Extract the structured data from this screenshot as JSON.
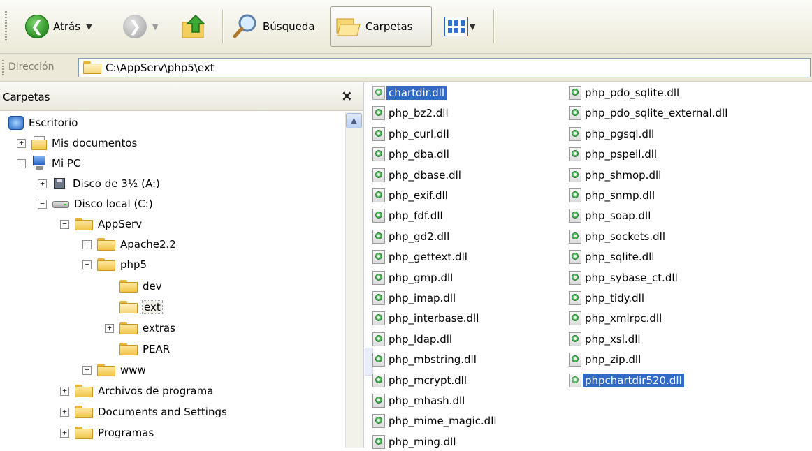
{
  "toolbar": {
    "back_label": "Atrás",
    "search_label": "Búsqueda",
    "folders_label": "Carpetas"
  },
  "address": {
    "label": "Dirección",
    "path": "C:\\AppServ\\php5\\ext"
  },
  "tree": {
    "title": "Carpetas",
    "close": "×",
    "nodes": [
      {
        "label": "Escritorio",
        "icon": "desktop-icon"
      },
      {
        "label": "Mis documentos",
        "icon": "my-documents-icon",
        "toggle": "+"
      },
      {
        "label": "Mi PC",
        "icon": "my-computer-icon",
        "toggle": "−"
      },
      {
        "label": "Disco de 3½ (A:)",
        "icon": "floppy-drive-icon",
        "toggle": "+"
      },
      {
        "label": "Disco local (C:)",
        "icon": "hard-drive-icon",
        "toggle": "−"
      },
      {
        "label": "AppServ",
        "icon": "folder-icon",
        "toggle": "−"
      },
      {
        "label": "Apache2.2",
        "icon": "folder-icon",
        "toggle": "+"
      },
      {
        "label": "php5",
        "icon": "folder-icon",
        "toggle": "−"
      },
      {
        "label": "dev",
        "icon": "folder-icon"
      },
      {
        "label": "ext",
        "icon": "open-folder-icon",
        "selected": true
      },
      {
        "label": "extras",
        "icon": "folder-icon",
        "toggle": "+"
      },
      {
        "label": "PEAR",
        "icon": "folder-icon"
      },
      {
        "label": "www",
        "icon": "folder-icon",
        "toggle": "+"
      },
      {
        "label": "Archivos de programa",
        "icon": "folder-icon",
        "toggle": "+"
      },
      {
        "label": "Documents and Settings",
        "icon": "folder-icon",
        "toggle": "+"
      },
      {
        "label": "Programas",
        "icon": "folder-icon",
        "toggle": "+"
      }
    ]
  },
  "files": {
    "column1": [
      {
        "name": "chartdir.dll",
        "selected": true
      },
      {
        "name": "php_bz2.dll"
      },
      {
        "name": "php_curl.dll"
      },
      {
        "name": "php_dba.dll"
      },
      {
        "name": "php_dbase.dll"
      },
      {
        "name": "php_exif.dll"
      },
      {
        "name": "php_fdf.dll"
      },
      {
        "name": "php_gd2.dll"
      },
      {
        "name": "php_gettext.dll"
      },
      {
        "name": "php_gmp.dll"
      },
      {
        "name": "php_imap.dll"
      },
      {
        "name": "php_interbase.dll"
      },
      {
        "name": "php_ldap.dll"
      },
      {
        "name": "php_mbstring.dll"
      },
      {
        "name": "php_mcrypt.dll"
      },
      {
        "name": "php_mhash.dll"
      },
      {
        "name": "php_mime_magic.dll"
      },
      {
        "name": "php_ming.dll"
      }
    ],
    "column2": [
      {
        "name": "php_pdo_sqlite.dll"
      },
      {
        "name": "php_pdo_sqlite_external.dll"
      },
      {
        "name": "php_pgsql.dll"
      },
      {
        "name": "php_pspell.dll"
      },
      {
        "name": "php_shmop.dll"
      },
      {
        "name": "php_snmp.dll"
      },
      {
        "name": "php_soap.dll"
      },
      {
        "name": "php_sockets.dll"
      },
      {
        "name": "php_sqlite.dll"
      },
      {
        "name": "php_sybase_ct.dll"
      },
      {
        "name": "php_tidy.dll"
      },
      {
        "name": "php_xmlrpc.dll"
      },
      {
        "name": "php_xsl.dll"
      },
      {
        "name": "php_zip.dll"
      },
      {
        "name": "phpchartdir520.dll",
        "selected": true
      }
    ]
  },
  "colors": {
    "selection": "#316ac5",
    "toolbar_bg": "#ece9d8",
    "back_button": "#2b8d24"
  }
}
